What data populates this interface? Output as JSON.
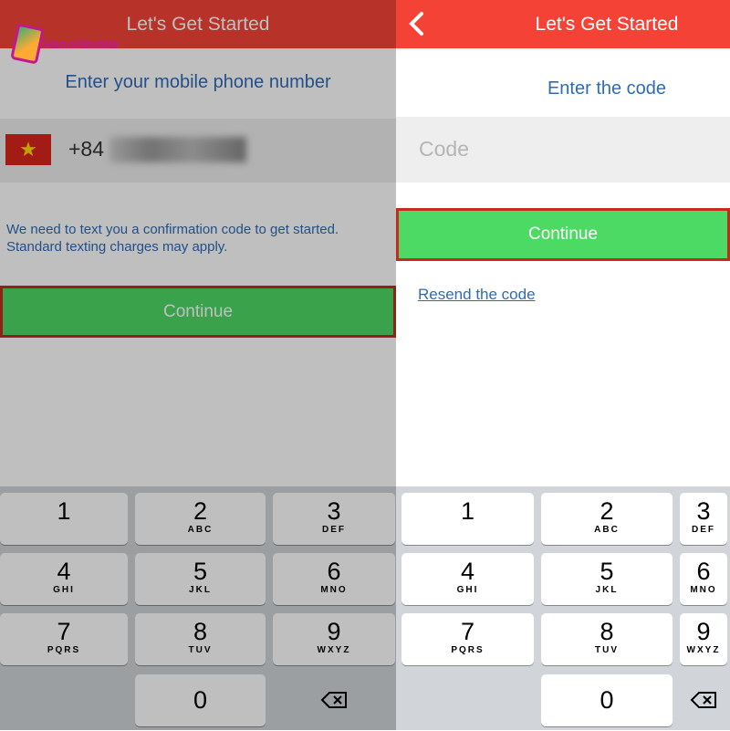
{
  "left": {
    "header_title": "Let's Get Started",
    "heading": "Enter your mobile phone number",
    "country_code": "+84",
    "flag": "vietnam-flag",
    "info_line1": "We need to text you a confirmation code to get started.",
    "info_line2": "Standard texting charges may apply.",
    "continue_label": "Continue",
    "dimmed": true
  },
  "right": {
    "header_title": "Let's Get Started",
    "back_icon": "chevron-left-icon",
    "heading": "Enter the code",
    "code_placeholder": "Code",
    "continue_label": "Continue",
    "resend_label": "Resend the code"
  },
  "keypad": [
    {
      "digit": "1",
      "letters": ""
    },
    {
      "digit": "2",
      "letters": "ABC"
    },
    {
      "digit": "3",
      "letters": "DEF"
    },
    {
      "digit": "4",
      "letters": "GHI"
    },
    {
      "digit": "5",
      "letters": "JKL"
    },
    {
      "digit": "6",
      "letters": "MNO"
    },
    {
      "digit": "7",
      "letters": "PQRS"
    },
    {
      "digit": "8",
      "letters": "TUV"
    },
    {
      "digit": "9",
      "letters": "WXYZ"
    },
    {
      "digit": "0",
      "letters": ""
    }
  ],
  "watermark": {
    "text": "HanoiMobile"
  },
  "colors": {
    "header": "#f44336",
    "continue": "#4cd964",
    "highlight_border": "#c62a1e",
    "link": "#2f6bb5"
  }
}
